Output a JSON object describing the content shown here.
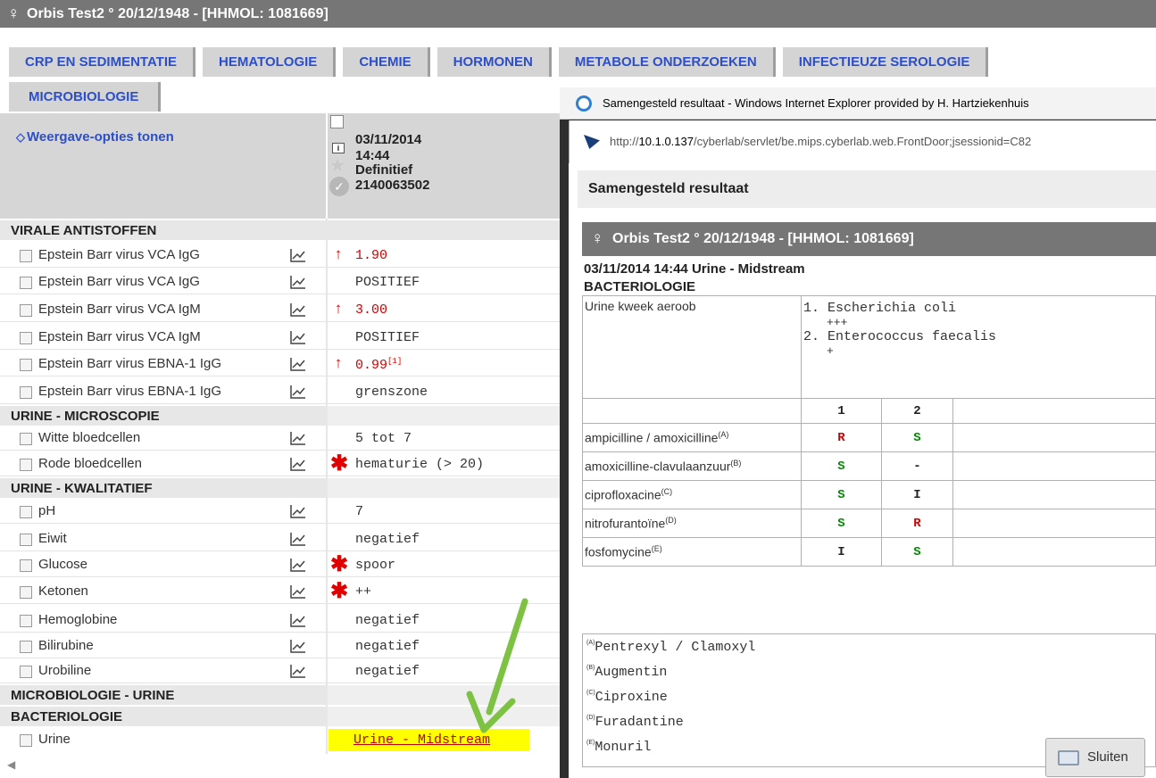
{
  "patient": {
    "female_symbol": "♀",
    "title": "Orbis Test2 ° 20/12/1948 - [HHMOL: 1081669]"
  },
  "tabs_row1": [
    "CRP EN SEDIMENTATIE",
    "HEMATOLOGIE",
    "CHEMIE",
    "HORMONEN",
    "METABOLE ONDERZOEKEN",
    "INFECTIEUZE SEROLOGIE"
  ],
  "tabs_row2": [
    "MICROBIOLOGIE"
  ],
  "view_options": "Weergave-opties tonen",
  "column": {
    "date": "03/11/2014",
    "time": "14:44",
    "status": "Definitief",
    "id": "2140063502"
  },
  "sections": {
    "viral": "VIRALE ANTISTOFFEN",
    "micro": "URINE  - MICROSCOPIE",
    "kwal": "URINE  - KWALITATIEF",
    "microbio": "MICROBIOLOGIE  - URINE",
    "bact": "BACTERIOLOGIE"
  },
  "rows": [
    {
      "label": "Epstein Barr virus VCA IgG",
      "flag": "↑",
      "value": "1.90"
    },
    {
      "label": "Epstein Barr virus VCA IgG",
      "flag": "",
      "value": "POSITIEF"
    },
    {
      "label": "Epstein Barr virus VCA IgM",
      "flag": "↑",
      "value": "3.00"
    },
    {
      "label": "Epstein Barr virus VCA IgM",
      "flag": "",
      "value": "POSITIEF"
    },
    {
      "label": "Epstein Barr virus EBNA-1 IgG",
      "flag": "↑",
      "value": "0.99",
      "note": "[1]"
    },
    {
      "label": "Epstein Barr virus EBNA-1 IgG",
      "flag": "",
      "value": "grenszone"
    },
    {
      "label": "Witte bloedcellen",
      "flag": "",
      "value": "5 tot 7"
    },
    {
      "label": "Rode bloedcellen",
      "flag": "✱",
      "value": "hematurie (> 20)"
    },
    {
      "label": "pH",
      "flag": "",
      "value": "7"
    },
    {
      "label": "Eiwit",
      "flag": "",
      "value": "negatief"
    },
    {
      "label": "Glucose",
      "flag": "✱",
      "value": "spoor"
    },
    {
      "label": "Ketonen",
      "flag": "✱",
      "value": "++"
    },
    {
      "label": "Hemoglobine",
      "flag": "",
      "value": "negatief"
    },
    {
      "label": "Bilirubine",
      "flag": "",
      "value": "negatief"
    },
    {
      "label": "Urobiline",
      "flag": "",
      "value": "negatief"
    },
    {
      "label": "Urine",
      "flag": "",
      "value": "Urine - Midstream"
    }
  ],
  "popup": {
    "window_title": "Samengesteld resultaat - Windows Internet Explorer provided by H. Hartziekenhuis",
    "url_prefix": "http://",
    "url_host": "10.1.0.137",
    "url_rest": "/cyberlab/servlet/be.mips.cyberlab.web.FrontDoor;jsessionid=C82",
    "heading": "Samengesteld resultaat",
    "sample": "03/11/2014 14:44 Urine - Midstream",
    "section": "BACTERIOLOGIE",
    "culture_label": "Urine kweek aeroob",
    "organisms": [
      {
        "name": "1. Escherichia coli",
        "growth": "+++"
      },
      {
        "name": "2. Enterococcus faecalis",
        "growth": "+"
      }
    ],
    "col_headers": [
      "1",
      "2"
    ],
    "antibiotics": [
      {
        "name": "ampicilline / amoxicilline",
        "ref": "(A)",
        "r1": "R",
        "r2": "S"
      },
      {
        "name": "amoxicilline-clavulaanzuur",
        "ref": "(B)",
        "r1": "S",
        "r2": "-"
      },
      {
        "name": "ciprofloxacine",
        "ref": "(C)",
        "r1": "S",
        "r2": "I"
      },
      {
        "name": "nitrofurantoïne",
        "ref": "(D)",
        "r1": "S",
        "r2": "R"
      },
      {
        "name": "fosfomycine",
        "ref": "(E)",
        "r1": "I",
        "r2": "S"
      }
    ],
    "footnotes": [
      {
        "key": "(A)",
        "text": "Pentrexyl / Clamoxyl"
      },
      {
        "key": "(B)",
        "text": "Augmentin"
      },
      {
        "key": "(C)",
        "text": "Ciproxine"
      },
      {
        "key": "(D)",
        "text": "Furadantine"
      },
      {
        "key": "(E)",
        "text": "Monuril"
      }
    ],
    "close_label": "Sluiten"
  },
  "colors": {
    "tab_text": "#2c4fc9",
    "alert_red": "#d40000",
    "sensitive_green": "#008a00",
    "highlight": "#ffff00",
    "arrow": "#7dc242"
  }
}
